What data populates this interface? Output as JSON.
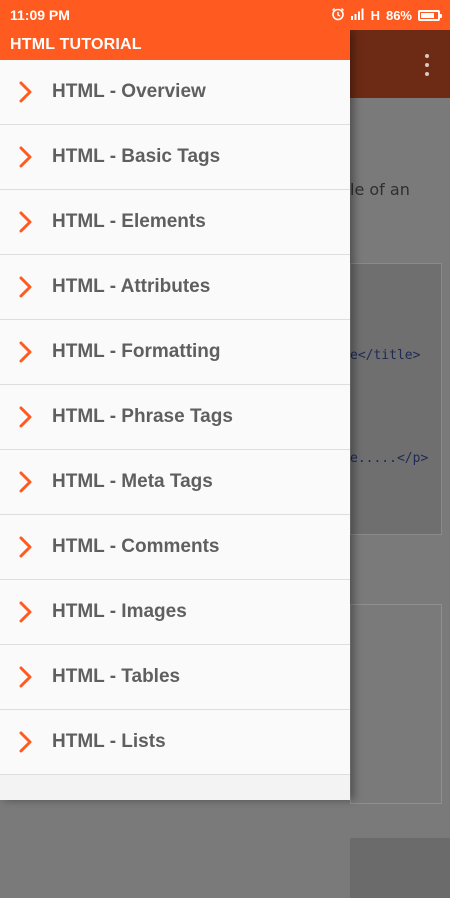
{
  "status_bar": {
    "time": "11:09 PM",
    "network": "H",
    "battery_percent_label": "86%",
    "battery_level": 0.86
  },
  "drawer": {
    "title": "HTML TUTORIAL",
    "items": [
      {
        "label": "HTML - Overview"
      },
      {
        "label": "HTML - Basic Tags"
      },
      {
        "label": "HTML - Elements"
      },
      {
        "label": "HTML - Attributes"
      },
      {
        "label": "HTML - Formatting"
      },
      {
        "label": "HTML - Phrase Tags"
      },
      {
        "label": "HTML - Meta Tags"
      },
      {
        "label": "HTML - Comments"
      },
      {
        "label": "HTML - Images"
      },
      {
        "label": "HTML - Tables"
      },
      {
        "label": "HTML - Lists"
      }
    ]
  },
  "background": {
    "paragraph_fragment": "le of an",
    "code_fragment_1": "e</title>",
    "code_fragment_2": "e.....</p>"
  },
  "colors": {
    "accent": "#ff5a1f",
    "chevron": "#ff5a1f",
    "item_text": "#5f5f5f"
  }
}
